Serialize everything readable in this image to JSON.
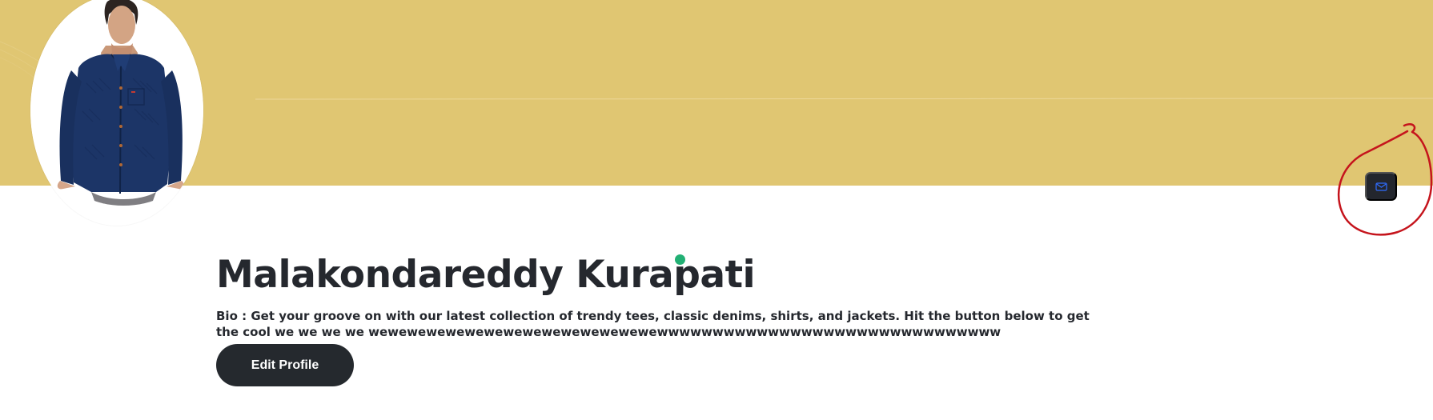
{
  "profile": {
    "name": "Malakondareddy Kurapati",
    "bio_label": "Bio :",
    "bio_text": "Get your groove on with our latest collection of trendy tees, classic denims, shirts, and jackets. Hit the button below to get the cool we we we we wewewewewewewewewewewewewewewewwwwwwwwwwwwwwwwwwwwwwwwwwwwwww",
    "online": true
  },
  "actions": {
    "edit_profile_label": "Edit Profile",
    "mail_icon": "mail-icon"
  },
  "colors": {
    "banner": "#e0c672",
    "button_dark": "#25292e",
    "online_status": "#22b074",
    "annotation": "#c5141c",
    "mail_icon": "#2f6cff"
  }
}
